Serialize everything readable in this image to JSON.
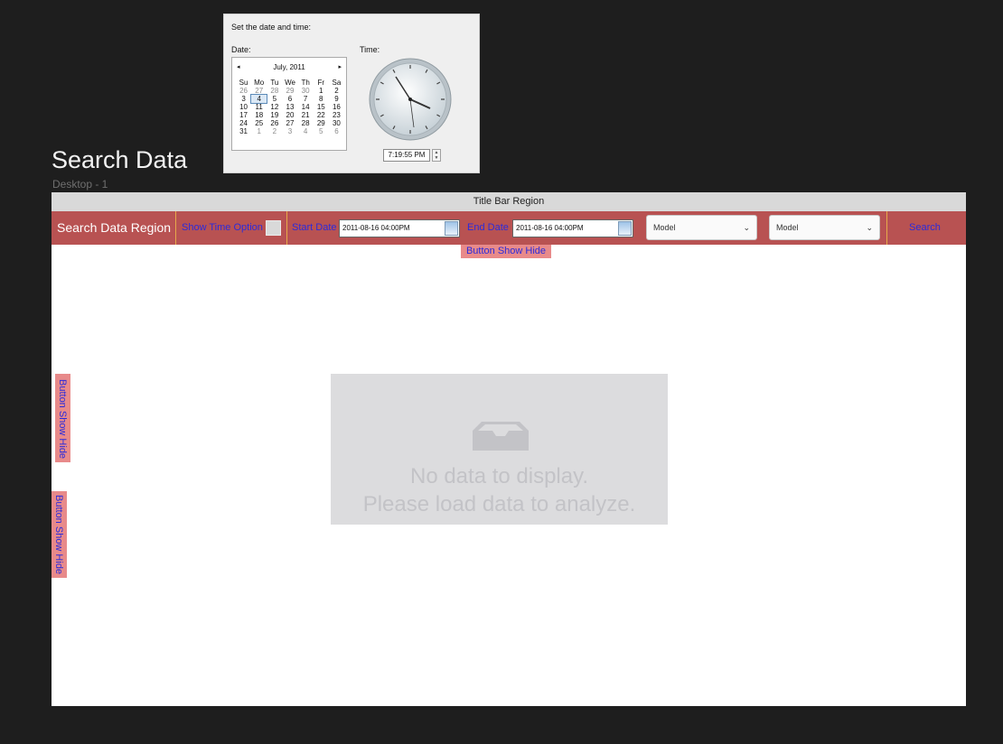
{
  "datetime_popup": {
    "heading": "Set the date and time:",
    "date_label": "Date:",
    "time_label": "Time:",
    "calendar": {
      "month_title": "July, 2011",
      "prev_glyph": "◂",
      "next_glyph": "▸",
      "weekdays": [
        "Su",
        "Mo",
        "Tu",
        "We",
        "Th",
        "Fr",
        "Sa"
      ],
      "weeks": [
        [
          "26",
          "27",
          "28",
          "29",
          "30",
          "1",
          "2"
        ],
        [
          "3",
          "4",
          "5",
          "6",
          "7",
          "8",
          "9"
        ],
        [
          "10",
          "11",
          "12",
          "13",
          "14",
          "15",
          "16"
        ],
        [
          "17",
          "18",
          "19",
          "20",
          "21",
          "22",
          "23"
        ],
        [
          "24",
          "25",
          "26",
          "27",
          "28",
          "29",
          "30"
        ],
        [
          "31",
          "1",
          "2",
          "3",
          "4",
          "5",
          "6"
        ]
      ],
      "selected_day": "4"
    },
    "time_value": "7:19:55 PM"
  },
  "page": {
    "heading": "Search Data",
    "subheading": "Desktop - 1"
  },
  "title_bar": {
    "label": "Title Bar Region"
  },
  "toolbar": {
    "region_label": "Search Data Region",
    "show_time_option": "Show Time Option",
    "start_date_label": "Start Date",
    "start_date_value": "2011-08-16 04:00PM",
    "end_date_label": "End Date",
    "end_date_value": "2011-08-16 04:00PM",
    "select1_value": "Model",
    "select2_value": "Model",
    "search_label": "Search"
  },
  "show_hide_buttons": {
    "top": "Button Show Hide",
    "left1": "Button Show Hide",
    "left2": "Button Show Hide"
  },
  "empty_state": {
    "line1": "No data to display.",
    "line2": "Please load data to analyze."
  },
  "colors": {
    "toolbar_bg": "#b85252",
    "show_hide_bg": "#e88a8a",
    "link_text": "#2b2bdb",
    "separator": "#e6a94b"
  }
}
